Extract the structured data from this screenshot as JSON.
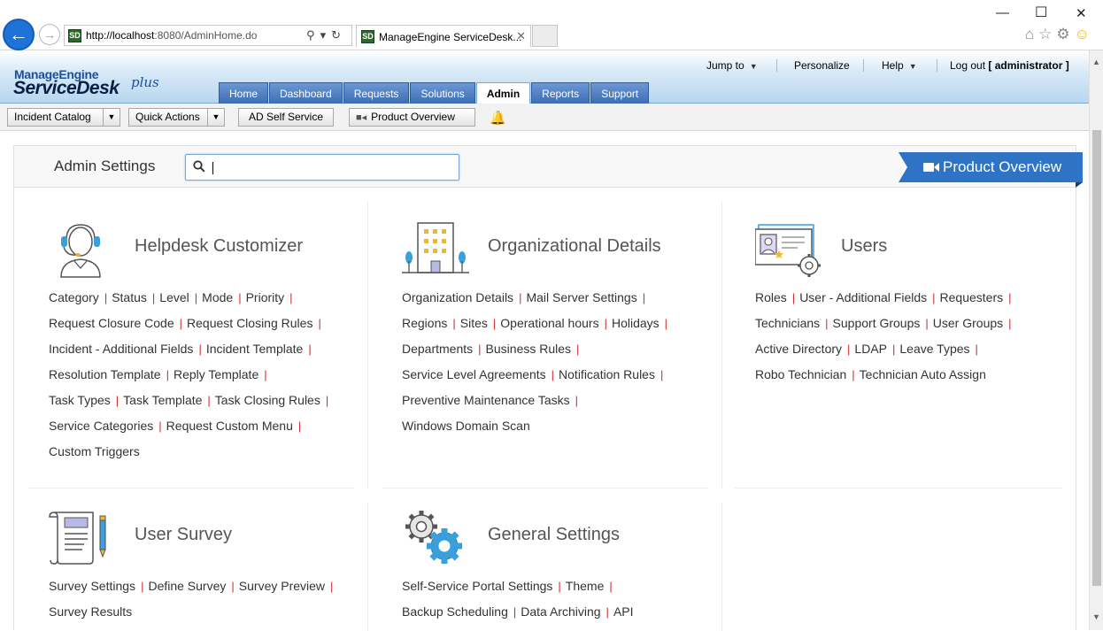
{
  "browser": {
    "url_host": "http://localhost",
    "url_rest": ":8080/AdminHome.do",
    "tab_title": "ManageEngine ServiceDesk...",
    "favicon_text": "SD"
  },
  "app": {
    "logo_top": "ManageEngine",
    "logo_main": "ServiceDesk",
    "logo_plus": "plus",
    "nav_tabs": [
      "Home",
      "Dashboard",
      "Requests",
      "Solutions",
      "Admin",
      "Reports",
      "Support"
    ],
    "active_tab": "Admin",
    "top_links": {
      "jump_to": "Jump to",
      "personalize": "Personalize",
      "help": "Help",
      "logout_prefix": "Log out",
      "logout_user": "[ administrator ]"
    }
  },
  "subbar": {
    "incident_catalog": "Incident Catalog",
    "quick_actions": "Quick Actions",
    "ad_self_service": "AD Self Service",
    "product_overview": "Product Overview"
  },
  "admin": {
    "title": "Admin Settings",
    "search_value": "",
    "search_placeholder": "",
    "product_overview": "Product Overview"
  },
  "sections": [
    {
      "title": "Helpdesk Customizer",
      "icon": "headset-user-icon",
      "rows": [
        [
          "Category",
          "Status",
          "Level",
          "Mode",
          "Priority"
        ],
        [
          "Request Closure Code",
          "Request Closing Rules"
        ],
        [
          "Incident - Additional Fields",
          "Incident Template"
        ],
        [
          "Resolution Template",
          "Reply Template"
        ],
        [
          "Task Types",
          "Task Template",
          "Task Closing Rules"
        ],
        [
          "Service Categories",
          "Request Custom Menu"
        ],
        [
          "Custom Triggers"
        ]
      ]
    },
    {
      "title": "Organizational Details",
      "icon": "building-icon",
      "rows": [
        [
          "Organization Details",
          "Mail Server Settings"
        ],
        [
          "Regions",
          "Sites",
          "Operational hours",
          "Holidays"
        ],
        [
          "Departments",
          "Business Rules"
        ],
        [
          "Service Level Agreements",
          "Notification Rules"
        ],
        [
          "Preventive Maintenance Tasks"
        ],
        [
          "Windows Domain Scan"
        ]
      ]
    },
    {
      "title": "Users",
      "icon": "user-card-gear-icon",
      "rows": [
        [
          "Roles",
          "User - Additional Fields",
          "Requesters"
        ],
        [
          "Technicians",
          "Support Groups",
          "User Groups"
        ],
        [
          "Active Directory",
          "LDAP",
          "Leave Types"
        ],
        [
          "Robo Technician",
          "Technician Auto Assign"
        ]
      ]
    },
    {
      "title": "User Survey",
      "icon": "survey-scroll-icon",
      "rows": [
        [
          "Survey Settings",
          "Define Survey",
          "Survey Preview"
        ],
        [
          "Survey Results"
        ]
      ]
    },
    {
      "title": "General Settings",
      "icon": "gears-icon",
      "rows": [
        [
          "Self-Service Portal Settings",
          "Theme"
        ],
        [
          "Backup Scheduling",
          "Data Archiving",
          "API"
        ]
      ]
    }
  ],
  "colors": {
    "nav_blue": "#3c6db5",
    "banner_blue": "#2f73c4",
    "link_separator": "#d22b2b"
  }
}
